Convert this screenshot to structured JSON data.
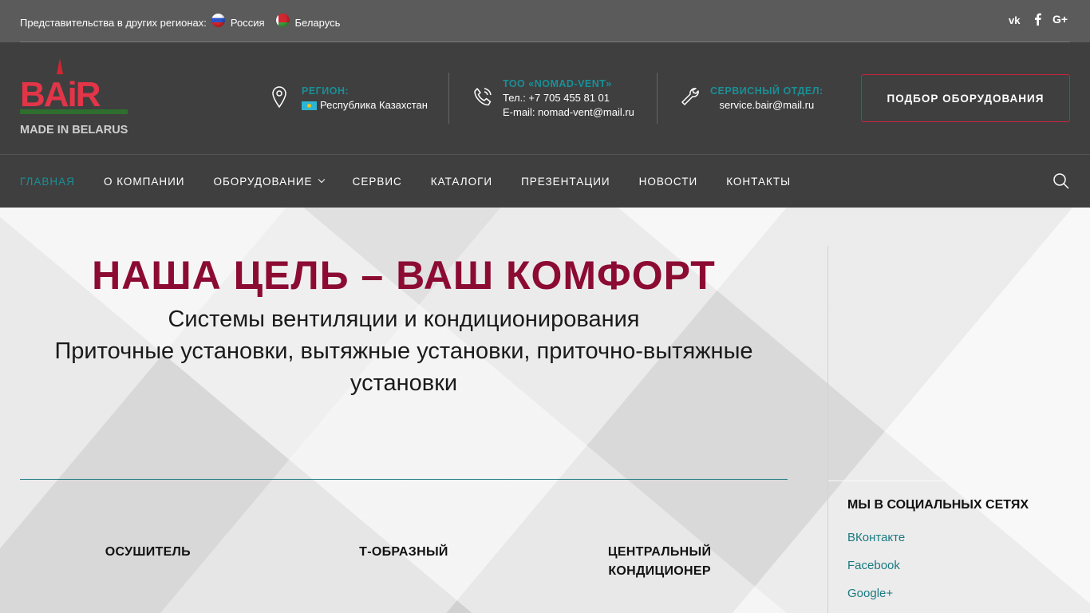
{
  "topbar": {
    "regions_label": "Представительства в других регионах:",
    "regions": [
      {
        "name": "Россия",
        "flag": "russia-flag"
      },
      {
        "name": "Беларусь",
        "flag": "belarus-flag"
      }
    ],
    "socials": [
      {
        "icon": "vk-icon",
        "glyph": "vk"
      },
      {
        "icon": "facebook-icon",
        "glyph": "f"
      },
      {
        "icon": "google-plus-icon",
        "glyph": "G+"
      }
    ]
  },
  "header": {
    "logo": {
      "brand": "BAiR",
      "tagline": "MADE IN BELARUS"
    },
    "region": {
      "label": "РЕГИОН:",
      "value": "Республика Казахстан"
    },
    "company": {
      "label": "ТОО «NOMAD-VENT»",
      "phone": "Тел.: +7 705 455 81 01",
      "email": "E-mail: nomad-vent@mail.ru"
    },
    "service": {
      "label": "СЕРВИСНЫЙ ОТДЕЛ:",
      "email": "service.bair@mail.ru"
    },
    "cta_button": "ПОДБОР ОБОРУДОВАНИЯ"
  },
  "nav": {
    "items": [
      {
        "label": "ГЛАВНАЯ",
        "active": true
      },
      {
        "label": "О КОМПАНИИ"
      },
      {
        "label": "ОБОРУДОВАНИЕ",
        "dropdown": true
      },
      {
        "label": "СЕРВИС"
      },
      {
        "label": "КАТАЛОГИ"
      },
      {
        "label": "ПРЕЗЕНТАЦИИ"
      },
      {
        "label": "НОВОСТИ"
      },
      {
        "label": "КОНТАКТЫ"
      }
    ]
  },
  "hero": {
    "title": "НАША ЦЕЛЬ – ВАШ КОМФОРТ",
    "subtitle_line1": "Системы вентиляции и кондиционирования",
    "subtitle_line2": "Приточные установки, вытяжные установки, приточно-вытяжные",
    "subtitle_line3": "установки"
  },
  "products": [
    {
      "line1": "ОСУШИТЕЛЬ",
      "line2": ""
    },
    {
      "line1": "Т-ОБРАЗНЫЙ",
      "line2": ""
    },
    {
      "line1": "ЦЕНТРАЛЬНЫЙ",
      "line2": "КОНДИЦИОНЕР"
    }
  ],
  "sidebar": {
    "title": "МЫ В СОЦИАЛЬНЫХ СЕТЯХ",
    "links": [
      "ВКонтакте",
      "Facebook",
      "Google+"
    ]
  },
  "colors": {
    "accent_teal": "#1a8f96",
    "brand_red": "#8c0b33",
    "cta_border": "#c8243b",
    "header_bg": "#3f3f3f",
    "topbar_bg": "#5b5b5b"
  }
}
